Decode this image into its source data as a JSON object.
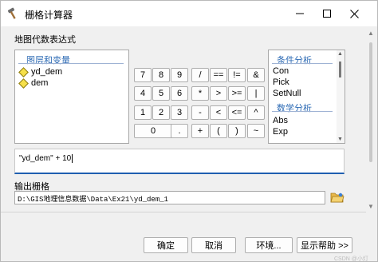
{
  "window": {
    "title": "栅格计算器",
    "icon": "hammer-icon",
    "minimize_icon": "minimize-icon",
    "maximize_icon": "maximize-icon",
    "close_icon": "close-icon"
  },
  "expression_section_label": "地图代数表达式",
  "layers_panel": {
    "title": "图层和变量",
    "items": [
      {
        "label": "yd_dem",
        "icon": "raster-layer-icon"
      },
      {
        "label": "dem",
        "icon": "raster-layer-icon"
      }
    ]
  },
  "keypad": {
    "rows": [
      [
        "7",
        "8",
        "9",
        "/",
        "==",
        "!=",
        "&"
      ],
      [
        "4",
        "5",
        "6",
        "*",
        ">",
        ">=",
        "|"
      ],
      [
        "1",
        "2",
        "3",
        "-",
        "<",
        "<=",
        "^"
      ],
      [
        "0",
        ".",
        "+",
        "(",
        ")",
        "~"
      ]
    ]
  },
  "functions_panel": {
    "categories": [
      {
        "name": "条件分析",
        "items": [
          "Con",
          "Pick",
          "SetNull"
        ]
      },
      {
        "name": "数学分析",
        "items": [
          "Abs",
          "Exp"
        ]
      }
    ]
  },
  "expression": {
    "value": "\"yd_dem\" + 10"
  },
  "output": {
    "label": "输出栅格",
    "value": "D:\\GIS地理信息数据\\Data\\Ex21\\yd_dem_1",
    "browse_icon": "open-folder-icon"
  },
  "buttons": {
    "ok": "确定",
    "cancel": "取消",
    "environments": "环境...",
    "show_help": "显示帮助 >>"
  },
  "watermark": "CSDN @小灯"
}
